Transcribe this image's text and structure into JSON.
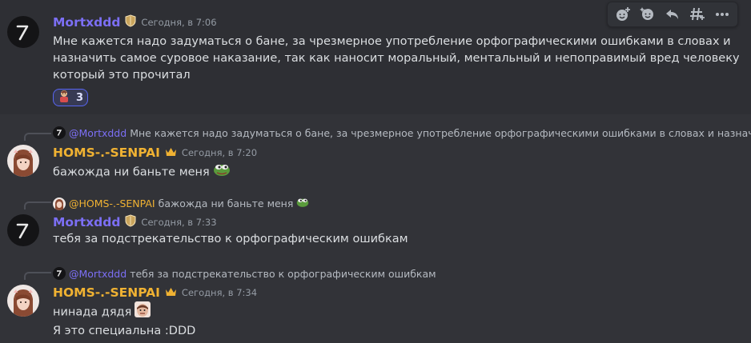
{
  "messages": [
    {
      "author": "Mortxddd",
      "timestamp": "Сегодня, в 7:06",
      "lines": [
        "Мне кажется надо задуматься о бане, за чрезмерное употребление орфографическими ошибками в словах и",
        "назначить самое суровое наказание, так как наносит моральный, ментальный и непоправимый вред человеку",
        "который это прочитал"
      ],
      "reaction": {
        "count": "3"
      }
    },
    {
      "reply": {
        "author": "@Mortxddd",
        "text": "Мне кажется надо задуматься о бане, за чрезмерное употребление орфографическими ошибками в словах и назначи"
      },
      "author": "HOMS-.-SENPAI",
      "timestamp": "Сегодня, в 7:20",
      "lines": [
        "бажождa ни баньте меня"
      ]
    },
    {
      "reply": {
        "author": "@HOMS-.-SENPAI",
        "text": "бажождa ни баньте меня"
      },
      "author": "Mortxddd",
      "timestamp": "Сегодня, в 7:33",
      "lines": [
        "тебя за подстрекательство к орфографическим ошибкам"
      ]
    },
    {
      "reply": {
        "author": "@Mortxddd",
        "text": "тебя за подстрекательство к орфографическим ошибкам"
      },
      "author": "HOMS-.-SENPAI",
      "timestamp": "Сегодня, в 7:34",
      "lines": [
        "нинада дядя",
        "Я это специальна :DDD"
      ]
    }
  ],
  "toolbar": {
    "icons": [
      "add-reaction-icon",
      "super-reaction-icon",
      "reply-icon",
      "create-thread-icon",
      "more-icon"
    ]
  },
  "colors": {
    "background": "#323338",
    "mortxddd_name": "#7c6ff5",
    "homs_name": "#f0b232",
    "timestamp": "#949ba4",
    "reaction_border": "#5865f2"
  }
}
